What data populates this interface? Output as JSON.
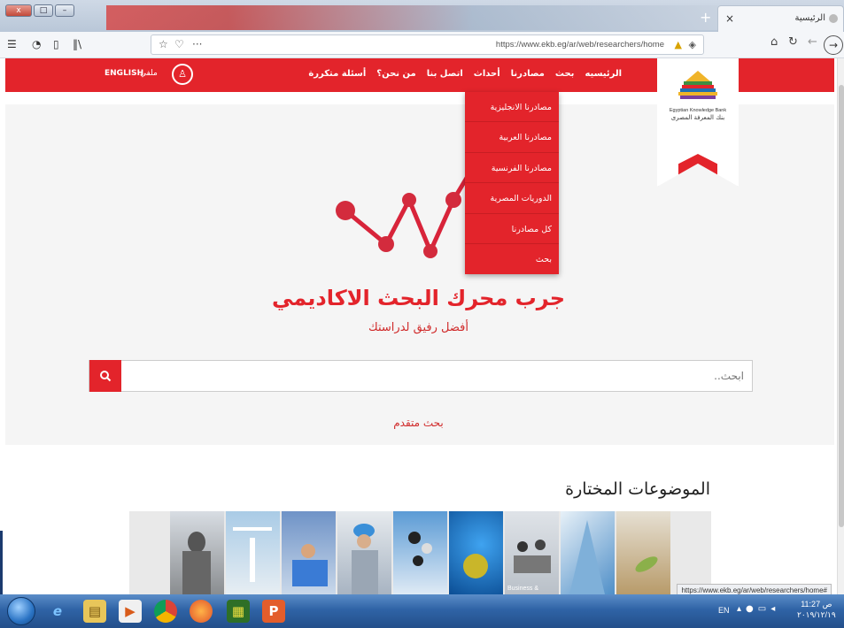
{
  "browser": {
    "tab_title": "الرئيسية",
    "url": "https://www.ekb.eg/ar/web/researchers/home",
    "url_domain_bold": "ekb.eg",
    "window_buttons": [
      "x",
      "□",
      "–"
    ],
    "new_tab": "+",
    "tab_close": "×",
    "overflow": "···"
  },
  "site": {
    "menu": [
      "الرئيسيه",
      "بحث",
      "مصادرنا",
      "أحداث",
      "اتصل بنا",
      "من نحن؟",
      "أسئلة متكررة"
    ],
    "language": "ENGLISH",
    "profile": "ملفي",
    "logo_en": "Egyptian Knowledge Bank",
    "logo_ar": "بنك المعرفة المصرى",
    "dropdown": [
      "مصادرنا الانجليزية",
      "مصادرنا العربية",
      "مصادرنا الفرنسية",
      "الدوريات المصرية",
      "كل مصادرنا",
      "بحث"
    ],
    "hero_title": "جرب محرك البحث الاكاديمي",
    "hero_subtitle": "أفضل رفيق لدراستك",
    "search_placeholder": "ابحث..",
    "advanced_search": "بحث متقدم",
    "featured_title": "الموضوعات المختارة",
    "tile_label": "Business &"
  },
  "status_bar_url": "https://www.ekb.eg/ar/web/researchers/home#",
  "taskbar": {
    "language": "EN",
    "time": "11:27 ص",
    "date": "٢٠١٩/١٢/١٩"
  },
  "colors": {
    "brand_red": "#e3242b"
  }
}
